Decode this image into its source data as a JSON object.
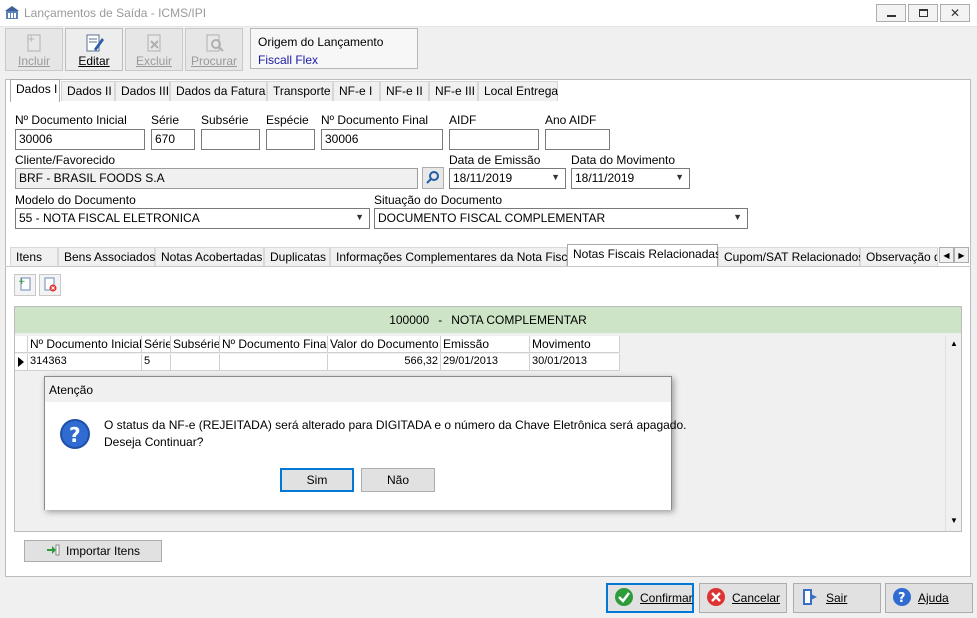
{
  "window": {
    "title": "Lançamentos de Saída - ICMS/IPI"
  },
  "toolbar": {
    "incluir": "Incluir",
    "editar": "Editar",
    "excluir": "Excluir",
    "procurar": "Procurar"
  },
  "origin": {
    "label": "Origem do Lançamento",
    "value": "Fiscall Flex"
  },
  "tabs": [
    "Dados I",
    "Dados II",
    "Dados III",
    "Dados da Fatura",
    "Transporte",
    "NF-e I",
    "NF-e II",
    "NF-e III",
    "Local Entrega"
  ],
  "form": {
    "doc_inicial_label": "Nº Documento Inicial",
    "doc_inicial": "30006",
    "serie_label": "Série",
    "serie": "670",
    "subserie_label": "Subsérie",
    "subserie": "",
    "especie_label": "Espécie",
    "especie": "",
    "doc_final_label": "Nº Documento Final",
    "doc_final": "30006",
    "aidf_label": "AIDF",
    "aidf": "",
    "ano_aidf_label": "Ano AIDF",
    "ano_aidf": "",
    "cliente_label": "Cliente/Favorecido",
    "cliente": "BRF - BRASIL FOODS S.A",
    "data_emissao_label": "Data de Emissão",
    "data_emissao": "18/11/2019",
    "data_movimento_label": "Data do Movimento",
    "data_movimento": "18/11/2019",
    "modelo_label": "Modelo do Documento",
    "modelo": "55 - NOTA FISCAL ELETRONICA",
    "situacao_label": "Situação do Documento",
    "situacao": "DOCUMENTO FISCAL COMPLEMENTAR"
  },
  "subtabs": [
    "Itens",
    "Bens Associados",
    "Notas Acobertadas",
    "Duplicatas",
    "Informações Complementares da Nota Fiscal",
    "Notas Fiscais Relacionadas",
    "Cupom/SAT Relacionados",
    "Observação d"
  ],
  "grid": {
    "group_code": "100000",
    "group_sep": "-",
    "group_name": "NOTA COMPLEMENTAR",
    "headers": [
      "Nº Documento Inicial",
      "Série",
      "Subsérie",
      "Nº Documento Final",
      "Valor do Documento",
      "Emissão",
      "Movimento"
    ],
    "rows": [
      [
        "314363",
        "5",
        "",
        "",
        "566,32",
        "29/01/2013",
        "30/01/2013"
      ]
    ]
  },
  "import_button": "Importar Itens",
  "dialog": {
    "title": "Atenção",
    "line1": "O status da NF-e (REJEITADA) será alterado para DIGITADA e o número da Chave Eletrônica será apagado.",
    "line2": "Deseja Continuar?",
    "yes": "Sim",
    "no": "Não"
  },
  "footer": {
    "confirmar": "Confirmar",
    "cancelar": "Cancelar",
    "sair": "Sair",
    "ajuda": "Ajuda"
  },
  "colors": {
    "accent": "#0078d7",
    "group_bar": "#cde4c6",
    "origin_value": "#1a1aa8"
  }
}
